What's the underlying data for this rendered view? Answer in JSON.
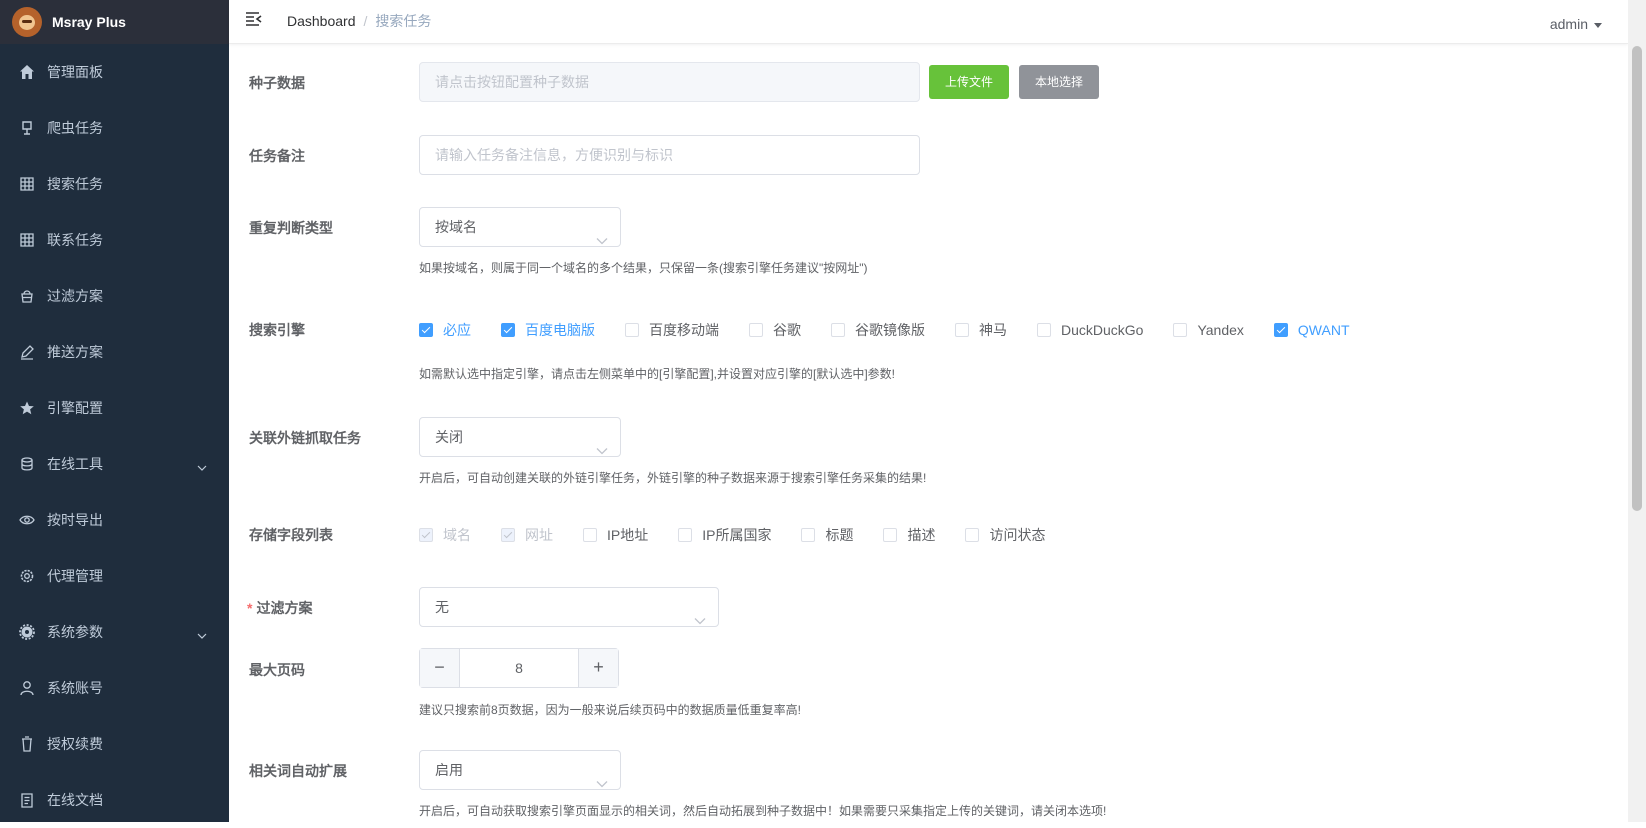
{
  "app": {
    "name": "Msray Plus"
  },
  "sidebar": {
    "items": [
      {
        "label": "管理面板",
        "icon": "home-icon"
      },
      {
        "label": "爬虫任务",
        "icon": "lamp-icon"
      },
      {
        "label": "搜索任务",
        "icon": "grid-icon"
      },
      {
        "label": "联系任务",
        "icon": "grid-icon"
      },
      {
        "label": "过滤方案",
        "icon": "basket-icon"
      },
      {
        "label": "推送方案",
        "icon": "edit-icon"
      },
      {
        "label": "引擎配置",
        "icon": "star-icon"
      },
      {
        "label": "在线工具",
        "icon": "coin-icon",
        "expandable": true
      },
      {
        "label": "按时导出",
        "icon": "eye-icon"
      },
      {
        "label": "代理管理",
        "icon": "gear-icon"
      },
      {
        "label": "系统参数",
        "icon": "gear-filled-icon",
        "expandable": true
      },
      {
        "label": "系统账号",
        "icon": "user-icon"
      },
      {
        "label": "授权续费",
        "icon": "cup-icon"
      },
      {
        "label": "在线文档",
        "icon": "doc-icon"
      }
    ]
  },
  "header": {
    "breadcrumb_home": "Dashboard",
    "breadcrumb_sep": "/",
    "breadcrumb_current": "搜索任务",
    "user": "admin"
  },
  "form": {
    "seed": {
      "label": "种子数据",
      "placeholder": "请点击按钮配置种子数据",
      "upload_button": "上传文件",
      "local_button": "本地选择"
    },
    "note": {
      "label": "任务备注",
      "placeholder": "请输入任务备注信息，方便识别与标识"
    },
    "dedup": {
      "label": "重复判断类型",
      "value": "按域名",
      "hint": "如果按域名，则属于同一个域名的多个结果，只保留一条(搜索引擎任务建议\"按网址\")"
    },
    "engines": {
      "label": "搜索引擎",
      "options": [
        {
          "label": "必应",
          "checked": true
        },
        {
          "label": "百度电脑版",
          "checked": true
        },
        {
          "label": "百度移动端",
          "checked": false
        },
        {
          "label": "谷歌",
          "checked": false
        },
        {
          "label": "谷歌镜像版",
          "checked": false
        },
        {
          "label": "神马",
          "checked": false
        },
        {
          "label": "DuckDuckGo",
          "checked": false
        },
        {
          "label": "Yandex",
          "checked": false
        },
        {
          "label": "QWANT",
          "checked": true
        }
      ],
      "hint": "如需默认选中指定引擎，请点击左侧菜单中的[引擎配置],并设置对应引擎的[默认选中]参数!"
    },
    "outlink": {
      "label": "关联外链抓取任务",
      "value": "关闭",
      "hint": "开启后，可自动创建关联的外链引擎任务，外链引擎的种子数据来源于搜索引擎任务采集的结果!"
    },
    "fields": {
      "label": "存储字段列表",
      "options": [
        {
          "label": "域名",
          "checked": true,
          "disabled": true
        },
        {
          "label": "网址",
          "checked": true,
          "disabled": true
        },
        {
          "label": "IP地址",
          "checked": false,
          "disabled": false
        },
        {
          "label": "IP所属国家",
          "checked": false,
          "disabled": false
        },
        {
          "label": "标题",
          "checked": false,
          "disabled": false
        },
        {
          "label": "描述",
          "checked": false,
          "disabled": false
        },
        {
          "label": "访问状态",
          "checked": false,
          "disabled": false
        }
      ]
    },
    "filter": {
      "required_mark": "*",
      "label": "过滤方案",
      "value": "无"
    },
    "max_page": {
      "label": "最大页码",
      "value": "8",
      "minus": "−",
      "plus": "+",
      "hint": "建议只搜索前8页数据，因为一般来说后续页码中的数据质量低重复率高!"
    },
    "related": {
      "label": "相关词自动扩展",
      "value": "启用",
      "hint": "开启后，可自动获取搜索引擎页面显示的相关词，然后自动拓展到种子数据中！如果需要只采集指定上传的关键词，请关闭本选项!"
    }
  },
  "colors": {
    "sidebar_bg": "#1f2d3d",
    "primary": "#409eff",
    "success": "#67c23a",
    "info": "#909399"
  }
}
